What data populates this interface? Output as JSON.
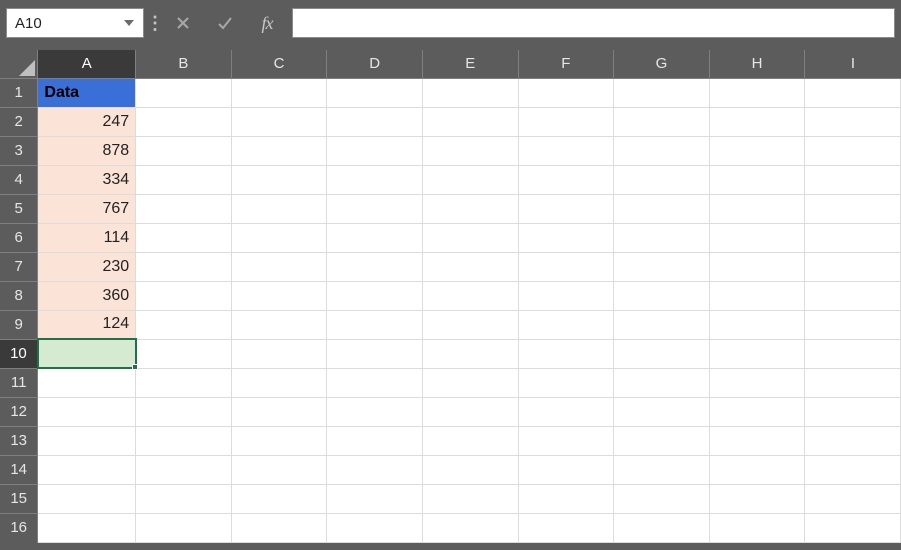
{
  "nameBox": {
    "value": "A10"
  },
  "formulaBar": {
    "value": ""
  },
  "columns": [
    "A",
    "B",
    "C",
    "D",
    "E",
    "F",
    "G",
    "H",
    "I"
  ],
  "activeColumn": "A",
  "rows": [
    1,
    2,
    3,
    4,
    5,
    6,
    7,
    8,
    9,
    10,
    11,
    12,
    13,
    14,
    15,
    16
  ],
  "activeRow": 10,
  "cells": {
    "A1": "Data",
    "A2": "247",
    "A3": "878",
    "A4": "334",
    "A5": "767",
    "A6": "114",
    "A7": "230",
    "A8": "360",
    "A9": "124"
  },
  "chart_data": {
    "type": "table",
    "title": "Data",
    "categories": [
      "A2",
      "A3",
      "A4",
      "A5",
      "A6",
      "A7",
      "A8",
      "A9"
    ],
    "values": [
      247,
      878,
      334,
      767,
      114,
      230,
      360,
      124
    ]
  }
}
